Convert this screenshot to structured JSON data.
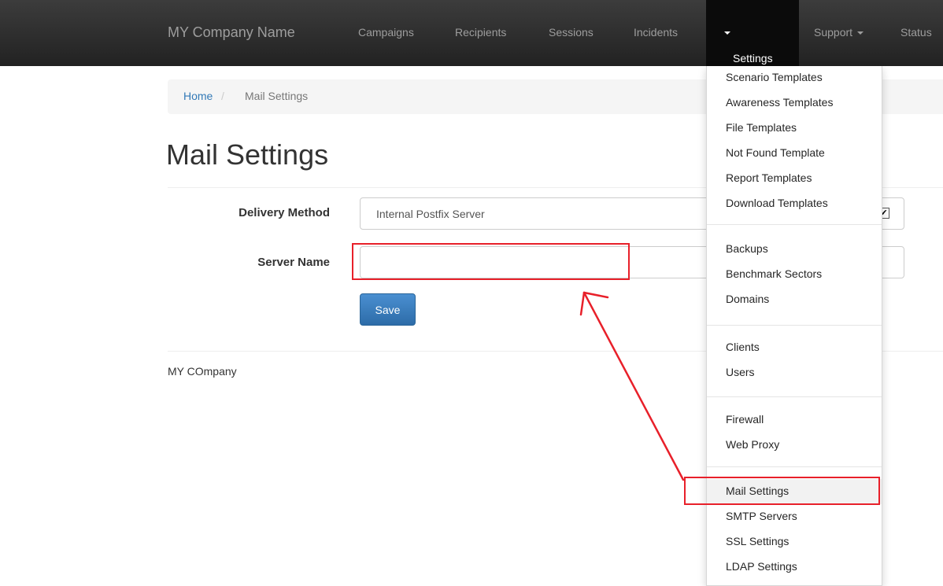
{
  "navbar": {
    "brand": "MY Company Name",
    "links": [
      "Campaigns",
      "Recipients",
      "Sessions",
      "Incidents"
    ],
    "settings_label": "Settings",
    "support_label": "Support",
    "status_label": "Status"
  },
  "breadcrumb": {
    "home": "Home",
    "separator": "/",
    "current": "Mail Settings"
  },
  "page": {
    "title": "Mail Settings"
  },
  "form": {
    "delivery_label": "Delivery Method",
    "delivery_value": "Internal Postfix Server",
    "server_label": "Server Name",
    "server_value": "",
    "save_label": "Save"
  },
  "footer": {
    "text": "MY COmpany"
  },
  "dropdown": {
    "groups": [
      [
        "Scenario Templates",
        "Awareness Templates",
        "File Templates",
        "Not Found Template",
        "Report Templates",
        "Download Templates"
      ],
      [
        "Backups",
        "Benchmark Sectors",
        "Domains"
      ],
      [
        "Clients",
        "Users"
      ],
      [
        "Firewall",
        "Web Proxy"
      ],
      [
        "Mail Settings",
        "SMTP Servers",
        "SSL Settings",
        "LDAP Settings"
      ]
    ],
    "active_item": "Mail Settings"
  },
  "colors": {
    "annotation": "#e8202a",
    "link": "#337ab7",
    "navbar": "#222222",
    "primary_button": "#337ab7"
  }
}
